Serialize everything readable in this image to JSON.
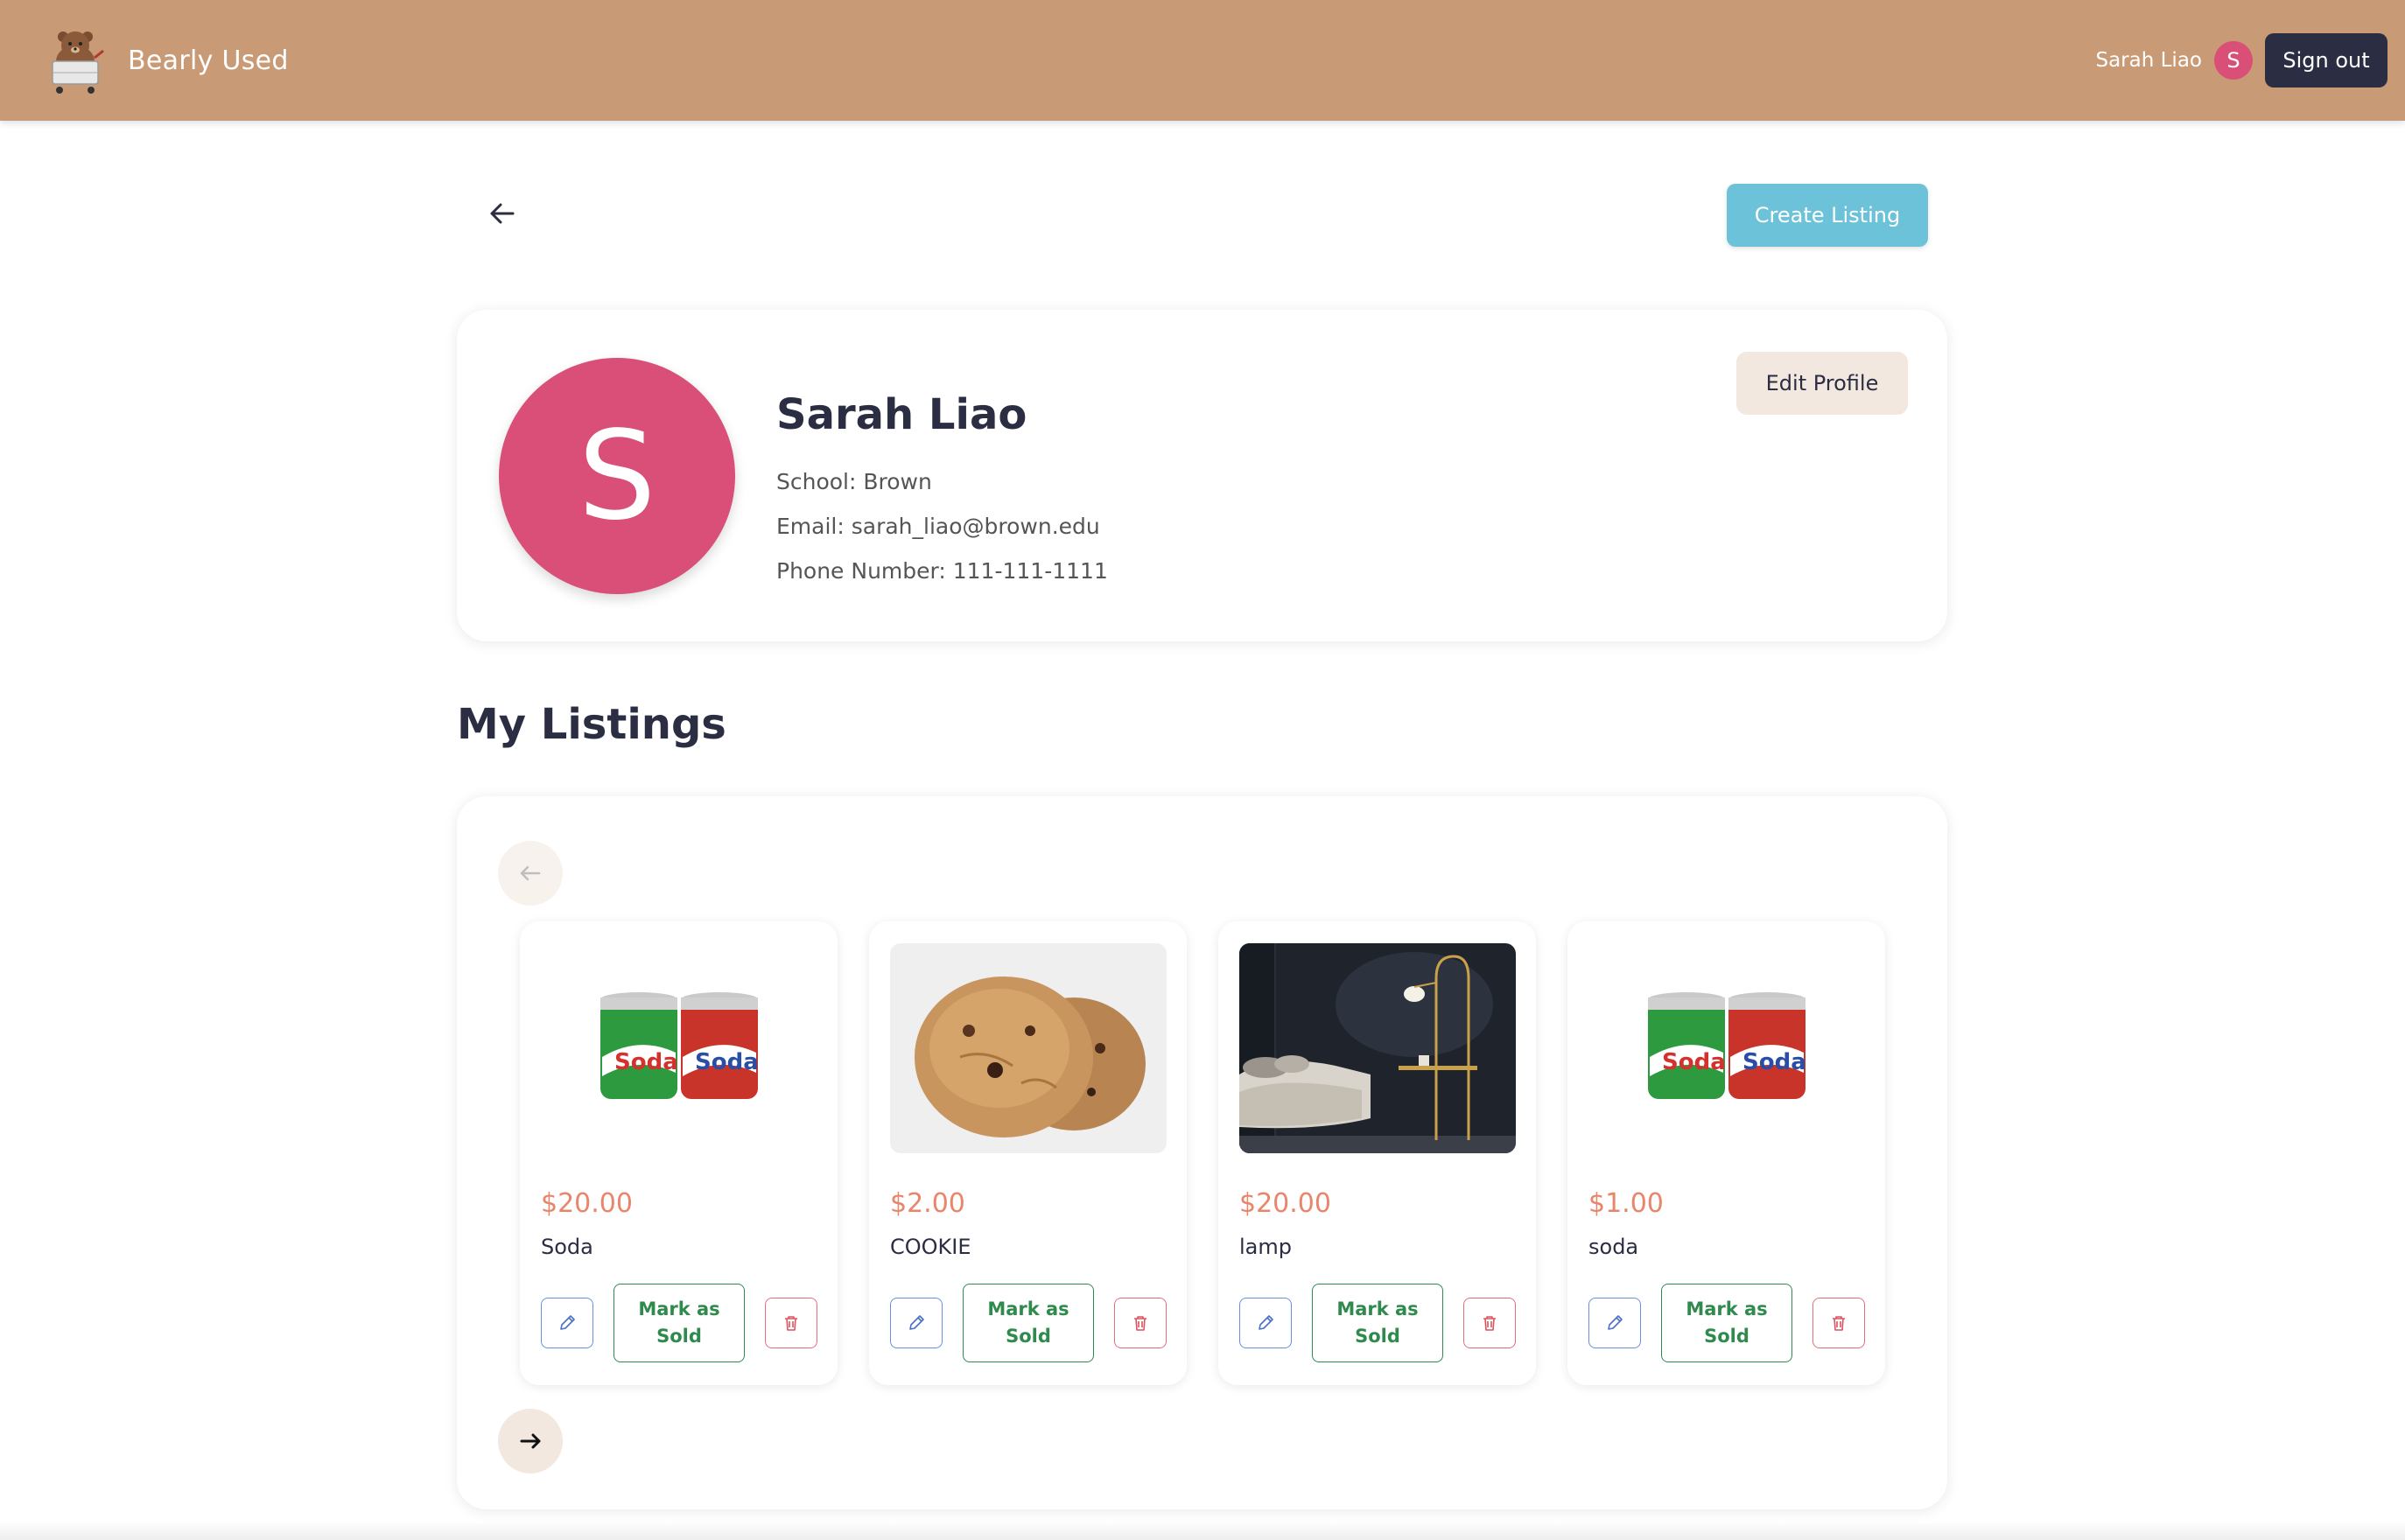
{
  "navbar": {
    "brand": "Bearly Used",
    "user_name": "Sarah Liao",
    "user_initial": "S",
    "sign_out_label": "Sign out",
    "background": "#c89a75"
  },
  "toolbar": {
    "create_listing_label": "Create Listing"
  },
  "profile": {
    "initial": "S",
    "name": "Sarah Liao",
    "school": "School: Brown",
    "email": "Email: sarah_liao@brown.edu",
    "phone": "Phone Number: 111-111-1111",
    "edit_label": "Edit Profile",
    "avatar_color": "#d94f77"
  },
  "listings": {
    "title": "My Listings",
    "items": [
      {
        "price": "$20.00",
        "title": "Soda",
        "image": "soda-cans-image",
        "sold_label": "Mark as Sold"
      },
      {
        "price": "$2.00",
        "title": "COOKIE",
        "image": "cookie-image",
        "sold_label": "Mark as Sold"
      },
      {
        "price": "$20.00",
        "title": "lamp",
        "image": "lamp-room-image",
        "sold_label": "Mark as Sold"
      },
      {
        "price": "$1.00",
        "title": "soda",
        "image": "soda-cans-image",
        "sold_label": "Mark as Sold"
      }
    ]
  },
  "colors": {
    "accent_blue": "#6cc2d8",
    "price": "#e8856a",
    "sold_green": "#2f8a4d",
    "delete_red": "#e0707a",
    "edit_blue": "#6b8fd8",
    "dark": "#2b2d42"
  }
}
